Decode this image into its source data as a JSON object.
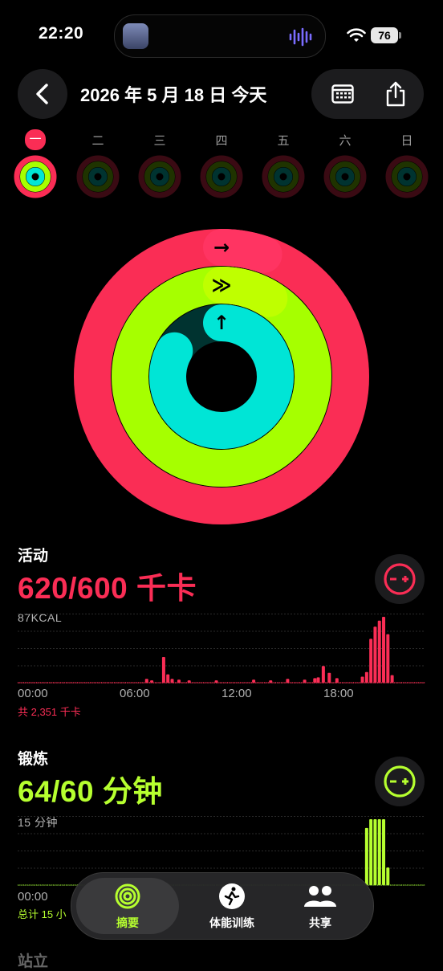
{
  "status_bar": {
    "time": "22:20",
    "battery": "76"
  },
  "header": {
    "date": "2026 年 5 月 18 日 今天"
  },
  "week": {
    "days": [
      "一",
      "二",
      "三",
      "四",
      "五",
      "六",
      "日"
    ],
    "selected_index": 0
  },
  "rings": {
    "move_progress": 1.033,
    "exercise_progress": 1.067,
    "stand_progress": 0.83,
    "colors": {
      "move": "#fa2d55",
      "exercise": "#a6ff00",
      "stand": "#00e5d6"
    }
  },
  "activity": {
    "title": "活动",
    "value": "620/600 千卡",
    "max_label": "87KCAL",
    "ticks": [
      "00:00",
      "06:00",
      "12:00",
      "18:00"
    ],
    "total": "共 2,351 千卡",
    "color": "#fa2d55"
  },
  "exercise": {
    "title": "锻炼",
    "value": "64/60 分钟",
    "max_label": "15 分钟",
    "ticks": [
      "00:00"
    ],
    "total": "总计 15 小",
    "color": "#b6ff2f"
  },
  "stand": {
    "title": "站立"
  },
  "chart_data": [
    {
      "type": "bar",
      "title": "活动",
      "ylabel": "87KCAL",
      "x_ticks": [
        "00:00",
        "06:00",
        "12:00",
        "18:00"
      ],
      "values": [
        0.5,
        0.5,
        0.5,
        0.5,
        0.5,
        0.5,
        0.5,
        0.5,
        0.5,
        0.5,
        0.5,
        0.5,
        0.5,
        0.5,
        0.5,
        0.5,
        0.5,
        0.5,
        0.5,
        0.5,
        0.5,
        0.5,
        0.5,
        0.5,
        0.5,
        0.5,
        0.5,
        0.5,
        0.5,
        0.5,
        0.5,
        0.5,
        0.5,
        0.5,
        0.5,
        0.5,
        0.5,
        0.5,
        0.5,
        0.5,
        0.5,
        0.5,
        0.5,
        0.5,
        0.5,
        0.5,
        0.5,
        0.5,
        0.5,
        0.5,
        0.5,
        0.5,
        0.5,
        0.5,
        0.5,
        0.5,
        0.5,
        0.5,
        0.5,
        0.5,
        0.5,
        0.5,
        0.5,
        0.5,
        0.5,
        0.5,
        0.5,
        0.5,
        0.5,
        0.5,
        0.5,
        0.5,
        0.5,
        0.5,
        0.5,
        0.5,
        0.5,
        0.5,
        0.5,
        0.5,
        0.5,
        0.5,
        0.5,
        0.5,
        0.5,
        0.5,
        0.5,
        0.5,
        0.5,
        0.5,
        0.5,
        0.5,
        0.5,
        0.5,
        0.5,
        0.5,
        0.5,
        0.5,
        0.5,
        0.5,
        0.5,
        0.5,
        0.5,
        0.5,
        0.5,
        0.5,
        0.5,
        0.5,
        0.5,
        0.5,
        0.5,
        0.5,
        0.5,
        0.5,
        0.5,
        0.5,
        0.5,
        0.5,
        0.5,
        0.5,
        0.5,
        0.5,
        0.5,
        0.5,
        0.5,
        0.5,
        0.5,
        0.5,
        0.5,
        0.5,
        0.5,
        0.5,
        0.5,
        0.5,
        0.5,
        0.5,
        0.5,
        0.5,
        0.5,
        0.5,
        0.5,
        0.5,
        0.5,
        0.5,
        0.5,
        0.5,
        0.5,
        0.5,
        0.5,
        0.5,
        0.5,
        0.5,
        0.5,
        0.5,
        0.5,
        0.5,
        0.5,
        0.5,
        0.5,
        0.5,
        0.5,
        0.5,
        0.5,
        0.5,
        0.5,
        0.5,
        0.5,
        0.5,
        0.5,
        0.5,
        0.5,
        0.5,
        0.5,
        0.5,
        0.5,
        0.5,
        0.5,
        0.5,
        0.5,
        0.5,
        0.5,
        0.5,
        0.5,
        0.5,
        0.5,
        0.5,
        0.5,
        0.5,
        0.5,
        0.5,
        0.5,
        0.5,
        0.5,
        0.5,
        0.5,
        0.5,
        0.5,
        0.5,
        0.5,
        0.5,
        0.5,
        0.5,
        0.5,
        0.5,
        0.5,
        0.5,
        0.5,
        0.5,
        0.5,
        0.5,
        0.5,
        0.5,
        0.5,
        0.5,
        0.5,
        0.5,
        0.5,
        0.5,
        0.5,
        0.5,
        0.5,
        0.5,
        0.5,
        0.5,
        0.5,
        0.5,
        0.5,
        0.5,
        0.5,
        0.5,
        0.5,
        0.5,
        0.5,
        0.5,
        0.5,
        0.5,
        0.5,
        0.5,
        0.5,
        0.5,
        0.5,
        0.5,
        0.5,
        0.5,
        0.5,
        0.5,
        0.5,
        0.5,
        0.5,
        0.5,
        0.5,
        0.5,
        0.5,
        0.5,
        0.5,
        0.5,
        0.5,
        0.5,
        0.5,
        0.5,
        0.5,
        0.5,
        0.5,
        0.5,
        0.5,
        0.5,
        0.5,
        0.5,
        0.5,
        0.5,
        0.5,
        0.5,
        0.5,
        0.5,
        0.5,
        0.5,
        0.5,
        0.5,
        0.5,
        0.5,
        0.5,
        0.5,
        0.5,
        0.5,
        0.5,
        0.5,
        0.5,
        0.5,
        0.5,
        0.5,
        0.5,
        0.5,
        0.5,
        0.5,
        0.5,
        0.5,
        0.5,
        0.5,
        0.5,
        0.5,
        0.5,
        0.5,
        0.5,
        0.5,
        0.5,
        0.5,
        0.5,
        0.5,
        0.5,
        0.5,
        0.5,
        0.5,
        0.5,
        0.5,
        0.5,
        0.5,
        0.5,
        0.5,
        0.5,
        0.5,
        0.5,
        0.5,
        0.5,
        0.5,
        0.5,
        0.5,
        0.5,
        0.5,
        0.5,
        0.5,
        0.5
      ],
      "events": [
        {
          "hour": 7.5,
          "kcal": 5
        },
        {
          "hour": 7.8,
          "kcal": 3
        },
        {
          "hour": 8.5,
          "kcal": 34
        },
        {
          "hour": 8.75,
          "kcal": 11
        },
        {
          "hour": 9.0,
          "kcal": 5
        },
        {
          "hour": 9.4,
          "kcal": 4
        },
        {
          "hour": 10.0,
          "kcal": 3
        },
        {
          "hour": 11.6,
          "kcal": 3
        },
        {
          "hour": 13.8,
          "kcal": 4
        },
        {
          "hour": 14.8,
          "kcal": 3
        },
        {
          "hour": 15.8,
          "kcal": 5
        },
        {
          "hour": 16.8,
          "kcal": 4
        },
        {
          "hour": 17.4,
          "kcal": 6
        },
        {
          "hour": 17.6,
          "kcal": 7
        },
        {
          "hour": 17.9,
          "kcal": 22
        },
        {
          "hour": 18.25,
          "kcal": 13
        },
        {
          "hour": 18.7,
          "kcal": 6
        },
        {
          "hour": 20.2,
          "kcal": 8
        },
        {
          "hour": 20.45,
          "kcal": 14
        },
        {
          "hour": 20.7,
          "kcal": 58
        },
        {
          "hour": 20.95,
          "kcal": 74
        },
        {
          "hour": 21.2,
          "kcal": 82
        },
        {
          "hour": 21.45,
          "kcal": 87
        },
        {
          "hour": 21.7,
          "kcal": 64
        },
        {
          "hour": 21.95,
          "kcal": 10
        }
      ]
    },
    {
      "type": "bar",
      "title": "锻炼",
      "ylabel": "15 分钟",
      "x_ticks": [
        "00:00"
      ],
      "events": [
        {
          "hour": 20.45,
          "minutes": 13
        },
        {
          "hour": 20.7,
          "minutes": 15
        },
        {
          "hour": 20.95,
          "minutes": 15
        },
        {
          "hour": 21.2,
          "minutes": 15
        },
        {
          "hour": 21.45,
          "minutes": 15
        },
        {
          "hour": 21.7,
          "minutes": 4
        }
      ]
    }
  ],
  "tabbar": {
    "tabs": [
      {
        "label": "摘要",
        "icon": "rings-icon"
      },
      {
        "label": "体能训练",
        "icon": "running-icon"
      },
      {
        "label": "共享",
        "icon": "people-icon"
      }
    ],
    "selected_index": 0
  }
}
